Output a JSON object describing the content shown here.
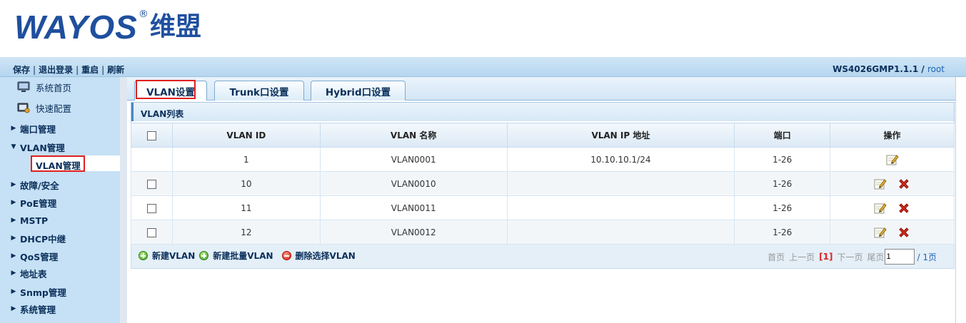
{
  "header": {
    "logo_text": "WAYOS",
    "logo_reg": "®",
    "logo_cn": "维盟"
  },
  "topbar": {
    "links": [
      "保存",
      "退出登录",
      "重启",
      "刷新"
    ],
    "model": "WS4026GMP1.1.1",
    "separator": " / ",
    "user": "root"
  },
  "sidebar": {
    "items": [
      {
        "label": "系统首页",
        "icon": "home-monitor-icon"
      },
      {
        "label": "快速配置",
        "icon": "quick-config-icon"
      },
      {
        "label": "端口管理",
        "icon": "caret-right-icon"
      },
      {
        "label": "VLAN管理",
        "icon": "caret-down-icon"
      },
      {
        "label": "故障/安全",
        "icon": "caret-right-icon"
      },
      {
        "label": "PoE管理",
        "icon": "caret-right-icon"
      },
      {
        "label": "MSTP",
        "icon": "caret-right-icon"
      },
      {
        "label": "DHCP中继",
        "icon": "caret-right-icon"
      },
      {
        "label": "QoS管理",
        "icon": "caret-right-icon"
      },
      {
        "label": "地址表",
        "icon": "caret-right-icon"
      },
      {
        "label": "Snmp管理",
        "icon": "caret-right-icon"
      },
      {
        "label": "系统管理",
        "icon": "caret-right-icon"
      }
    ],
    "sub_active": "VLAN管理"
  },
  "tabs": [
    "VLAN设置",
    "Trunk口设置",
    "Hybrid口设置"
  ],
  "panel": {
    "title": "VLAN列表",
    "columns": [
      "",
      "VLAN ID",
      "VLAN 名称",
      "VLAN IP 地址",
      "端口",
      "操作"
    ],
    "rows": [
      {
        "id": "1",
        "name": "VLAN0001",
        "ip": "10.10.10.1/24",
        "ports": "1-26",
        "checkbox": false,
        "deletable": false
      },
      {
        "id": "10",
        "name": "VLAN0010",
        "ip": "",
        "ports": "1-26",
        "checkbox": true,
        "deletable": true
      },
      {
        "id": "11",
        "name": "VLAN0011",
        "ip": "",
        "ports": "1-26",
        "checkbox": true,
        "deletable": true
      },
      {
        "id": "12",
        "name": "VLAN0012",
        "ip": "",
        "ports": "1-26",
        "checkbox": true,
        "deletable": true
      }
    ]
  },
  "footer": {
    "actions": [
      "新建VLAN",
      "新建批量VLAN",
      "删除选择VLAN"
    ],
    "pager": {
      "first": "首页",
      "prev": "上一页",
      "current": "[1]",
      "next": "下一页",
      "last": "尾页",
      "input_value": "1",
      "total": "/ 1页"
    }
  },
  "colors": {
    "brand": "#1f4f9e",
    "highlight": "#e02020"
  }
}
